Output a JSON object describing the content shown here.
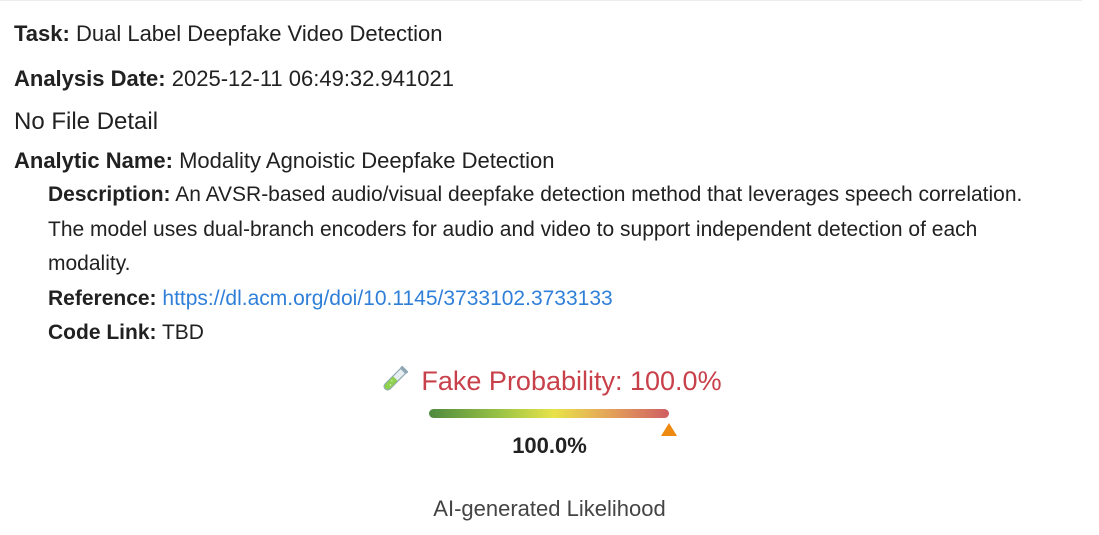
{
  "task": {
    "label": "Task:",
    "value": "Dual Label Deepfake Video Detection"
  },
  "analysis_date": {
    "label": "Analysis Date:",
    "value": "2025-12-11 06:49:32.941021"
  },
  "file_detail": "No File Detail",
  "analytic": {
    "name_label": "Analytic Name:",
    "name": "Modality Agnoistic Deepfake Detection",
    "description_label": "Description:",
    "description": "An AVSR-based audio/visual deepfake detection method that leverages speech correlation. The model uses dual-branch encoders for audio and video to support independent detection of each modality.",
    "reference_label": "Reference:",
    "reference_url": "https://dl.acm.org/doi/10.1145/3733102.3733133",
    "code_link_label": "Code Link:",
    "code_link": "TBD"
  },
  "result": {
    "icon": "test-tube-icon",
    "heading": "Fake Probability: 100.0%",
    "probability_percent": 100.0,
    "gauge_value_text": "100.0%",
    "caption": "AI-generated Likelihood",
    "colors": {
      "heading": "#c8404a",
      "marker": "#ef8a10",
      "gauge_low": "#4e8a3f",
      "gauge_mid": "#e8e34a",
      "gauge_high": "#cf5f63",
      "link": "#2f7fd8"
    }
  }
}
